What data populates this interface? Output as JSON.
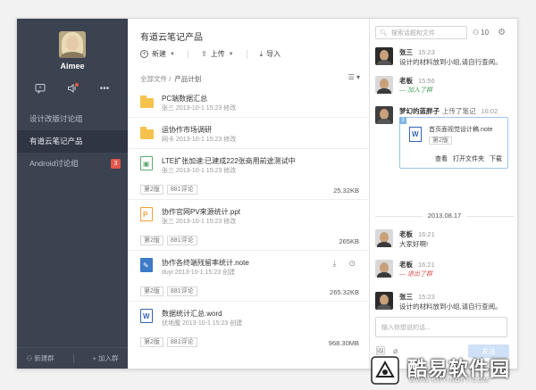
{
  "sidebar": {
    "username": "Aimee",
    "groups": [
      {
        "label": "设计改版讨论组",
        "badge": ""
      },
      {
        "label": "有道云笔记产品",
        "badge": ""
      },
      {
        "label": "Android讨论组",
        "badge": "3"
      }
    ],
    "new_group": "新建群",
    "join_group": "加入群"
  },
  "main": {
    "title": "有道云笔记产品",
    "toolbar": {
      "new": "新建",
      "upload": "上传",
      "import": "导入"
    },
    "breadcrumb": {
      "root": "全部文件",
      "sep": "/",
      "current": "产品计划"
    },
    "files": [
      {
        "name": "PC端数据汇总",
        "meta": "张三  2013-10-1 15:23  修改",
        "type": "folder"
      },
      {
        "name": "运协作市场调研",
        "meta": "网卡  2013-10-1 15:23  修改",
        "type": "folder"
      },
      {
        "name": "LTE扩张加速:已建成222张商用前途测试中",
        "meta": "张三  2013-10-1 15:23  修改",
        "type": "image",
        "version": "第2版",
        "comments": "881评论",
        "size": "25.32KB"
      },
      {
        "name": "协作官网PV来源统计.ppt",
        "meta": "张三  2013-10-1 15:23  修改",
        "type": "ppt",
        "version": "第2版",
        "comments": "881评论",
        "size": "265KB"
      },
      {
        "name": "协作各终端残留率统计.note",
        "meta": "duyi  2013-10-1 15:23  创建",
        "type": "note",
        "version": "第2版",
        "comments": "881评论",
        "size": "265.32KB"
      },
      {
        "name": "数据统计汇总.word",
        "meta": "伏地魔  2013-10-1 15:23  创建",
        "type": "word",
        "version": "第2版",
        "comments": "881评论",
        "size": "968.30MB"
      }
    ]
  },
  "chat": {
    "search_placeholder": "搜索话题和文件",
    "member_count": "10",
    "messages": [
      {
        "name": "张三",
        "time": "15:23",
        "text": "设计的材料放到小组,请自行查阅。"
      },
      {
        "name": "老板",
        "time": "15:56",
        "system": "加入了群"
      },
      {
        "name": "梦幻的蓝胖子",
        "action": "上传了笔记",
        "time": "16:02"
      },
      {
        "name": "老板",
        "time": "16:21",
        "text": "大家好啊!"
      },
      {
        "name": "老板",
        "time": "16:21",
        "system": "退出了群"
      },
      {
        "name": "张三",
        "time": "15:23",
        "text": "设计的材料放到小组,请自行查阅。"
      }
    ],
    "card": {
      "corner": "3",
      "title": "首页面视觉设计稿.note",
      "version": "第2版",
      "view": "查看",
      "open_folder": "打开文件夹",
      "download": "下载"
    },
    "date_separator": "2013.08.17",
    "input_placeholder": "输入你想说的话...",
    "send": "发送"
  },
  "watermark": {
    "text": "酷易软件园",
    "url": "WWW.KUYISOFT.COM"
  }
}
